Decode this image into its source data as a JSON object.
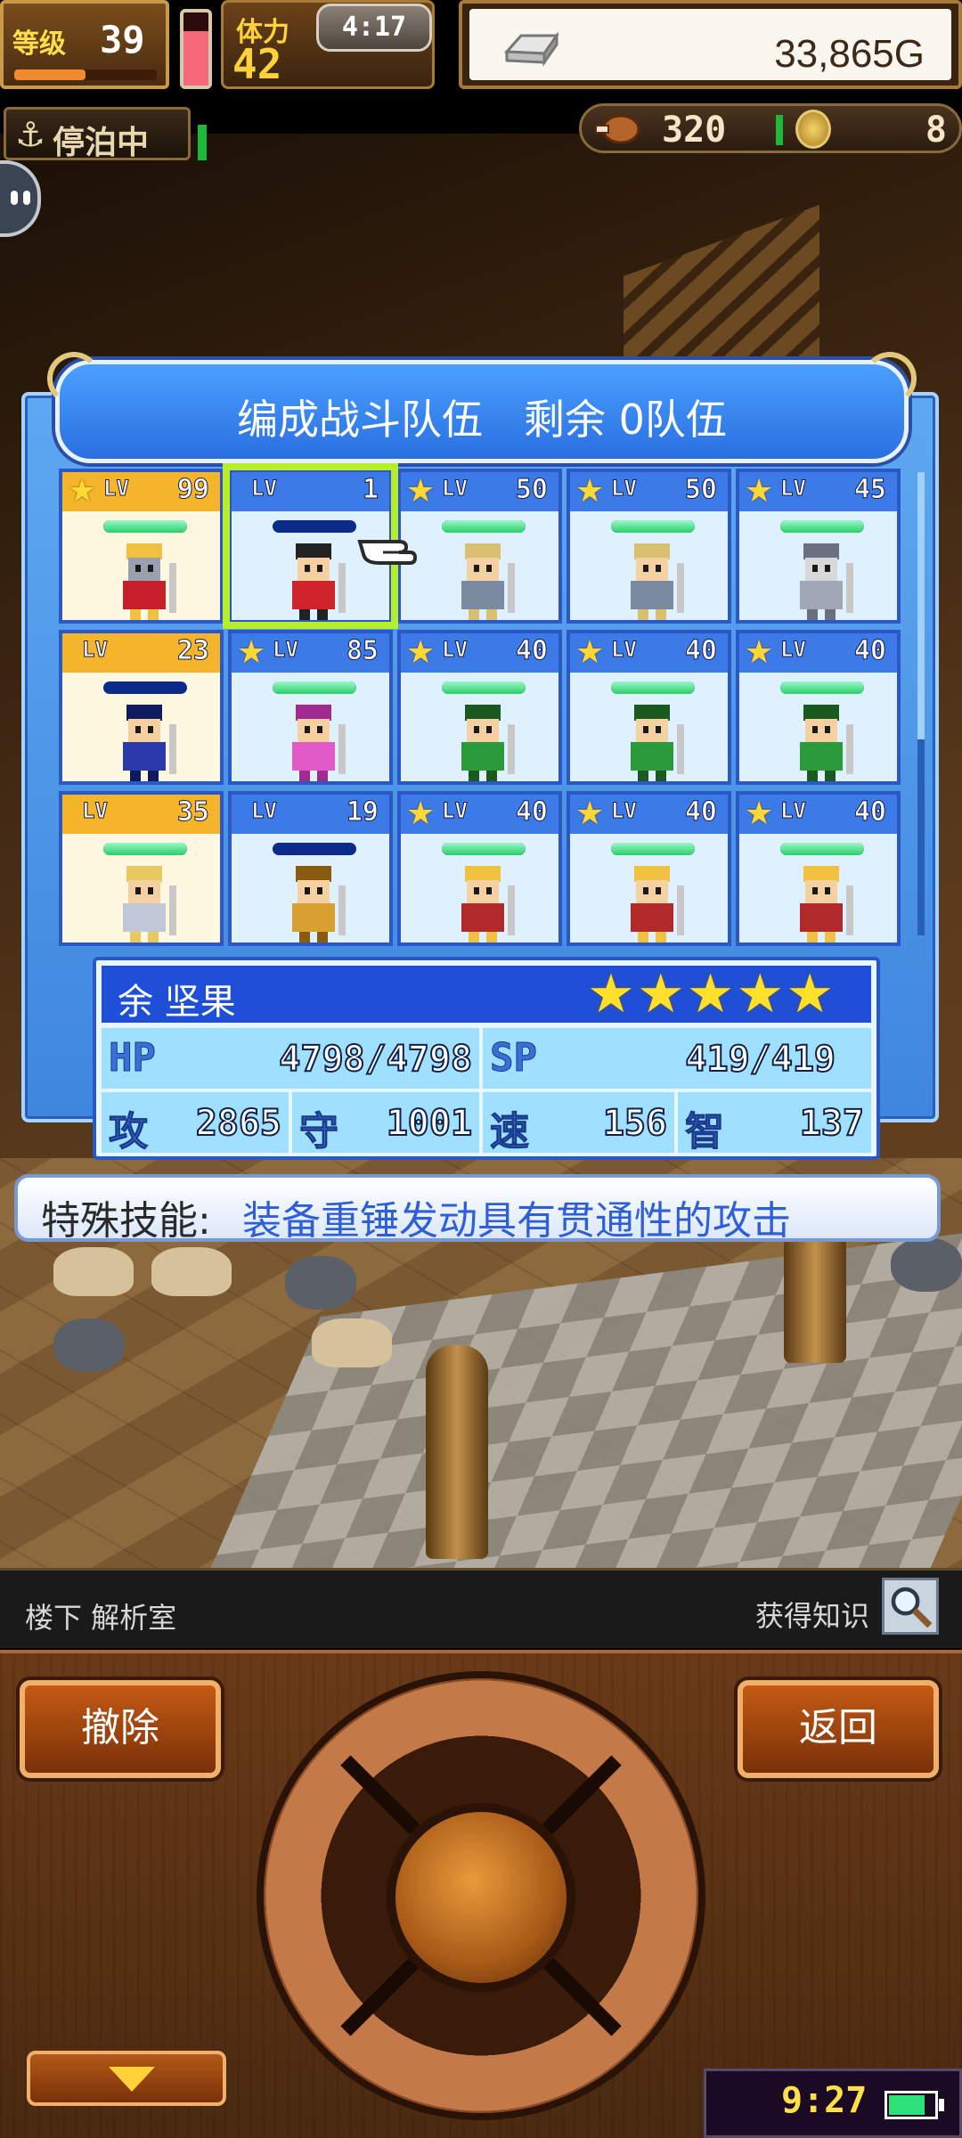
{
  "hud": {
    "level_label": "等级",
    "level": "39",
    "xp_fraction": 0.5,
    "stamina_label": "体力",
    "stamina": "42",
    "stamina_gauge_fraction": 0.75,
    "clock": "4:17",
    "gold": "33,865G",
    "dock_status": "停泊中",
    "food": "320",
    "medals": "8"
  },
  "panel": {
    "title": "编成战斗队伍　剩余 0队伍"
  },
  "roster": [
    {
      "star": true,
      "lv_label": "LV",
      "level": "99",
      "in_party": true,
      "hp": 1.0,
      "sprite": "red-knight"
    },
    {
      "star": false,
      "lv_label": "LV",
      "level": "1",
      "in_party": false,
      "hp": 0.0,
      "sprite": "pirate-captain",
      "selected": true
    },
    {
      "star": true,
      "lv_label": "LV",
      "level": "50",
      "in_party": false,
      "hp": 1.0,
      "sprite": "viking"
    },
    {
      "star": true,
      "lv_label": "LV",
      "level": "50",
      "in_party": false,
      "hp": 1.0,
      "sprite": "viking"
    },
    {
      "star": true,
      "lv_label": "LV",
      "level": "45",
      "in_party": false,
      "hp": 1.0,
      "sprite": "armored-knight"
    },
    {
      "star": false,
      "lv_label": "LV",
      "level": "23",
      "in_party": true,
      "hp": 0.0,
      "sprite": "ninja"
    },
    {
      "star": true,
      "lv_label": "LV",
      "level": "85",
      "in_party": false,
      "hp": 1.0,
      "sprite": "pink-ninja"
    },
    {
      "star": true,
      "lv_label": "LV",
      "level": "40",
      "in_party": false,
      "hp": 1.0,
      "sprite": "green-pirate"
    },
    {
      "star": true,
      "lv_label": "LV",
      "level": "40",
      "in_party": false,
      "hp": 1.0,
      "sprite": "green-pirate"
    },
    {
      "star": true,
      "lv_label": "LV",
      "level": "40",
      "in_party": false,
      "hp": 1.0,
      "sprite": "green-pirate"
    },
    {
      "star": false,
      "lv_label": "LV",
      "level": "35",
      "in_party": true,
      "hp": 1.0,
      "sprite": "valkyrie"
    },
    {
      "star": false,
      "lv_label": "LV",
      "level": "19",
      "in_party": false,
      "hp": 0.0,
      "sprite": "gold-warrior"
    },
    {
      "star": true,
      "lv_label": "LV",
      "level": "40",
      "in_party": false,
      "hp": 1.0,
      "sprite": "red-pirate"
    },
    {
      "star": true,
      "lv_label": "LV",
      "level": "40",
      "in_party": false,
      "hp": 1.0,
      "sprite": "red-pirate"
    },
    {
      "star": true,
      "lv_label": "LV",
      "level": "40",
      "in_party": false,
      "hp": 1.0,
      "sprite": "red-pirate"
    }
  ],
  "detail": {
    "name": "余 坚果",
    "stars": "★★★★★",
    "hp_label": "HP",
    "hp": "4798/4798",
    "sp_label": "SP",
    "sp": "419/419",
    "atk_label": "攻",
    "atk": "2865",
    "def_label": "守",
    "def": "1001",
    "spd_label": "速",
    "spd": "156",
    "int_label": "智",
    "int": "137"
  },
  "skill": {
    "label": "特殊技能:",
    "text": "装备重锤发动具有贯通性的攻击"
  },
  "location": {
    "place": "楼下 解析室",
    "action": "获得知识"
  },
  "controls": {
    "remove_label": "撤除",
    "back_label": "返回",
    "game_time": "9:27"
  },
  "colors": {
    "panel_blue": "#3f86de",
    "party_gold": "#f5b52a",
    "selection_green": "#b6ee2c",
    "skill_blue": "#2f5fd8"
  }
}
